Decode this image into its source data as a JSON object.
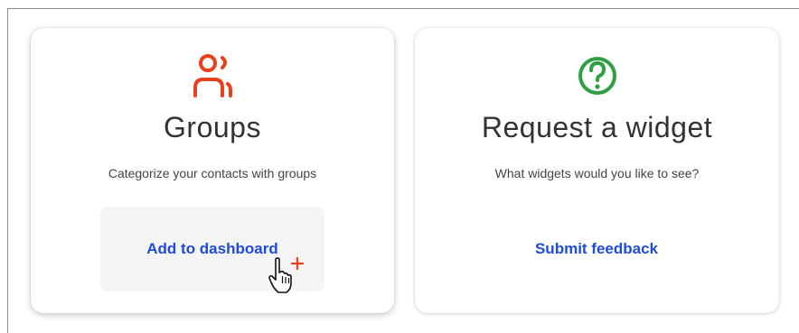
{
  "cards": [
    {
      "icon": "groups-icon",
      "icon_color": "#e8401c",
      "title": "Groups",
      "description": "Categorize your contacts with groups",
      "action_label": "Add to dashboard"
    },
    {
      "icon": "question-circle-icon",
      "icon_color": "#2ea043",
      "title": "Request a widget",
      "description": "What widgets would you like to see?",
      "action_label": "Submit feedback"
    }
  ],
  "cursor": {
    "icon": "hand-pointer-add-cursor",
    "plus_color": "#e8401c"
  },
  "colors": {
    "link": "#1f4bd8",
    "hover_bg": "#f4f4f4"
  }
}
